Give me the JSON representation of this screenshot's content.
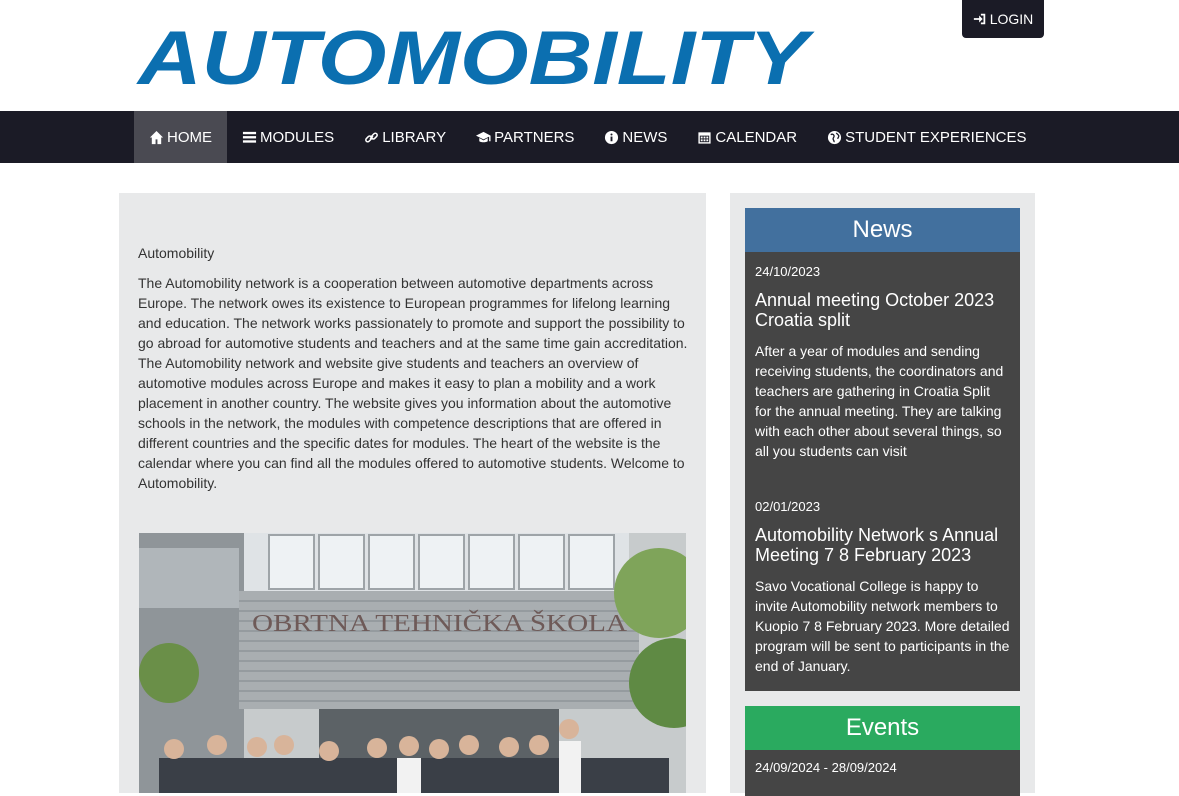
{
  "header": {
    "logo_text": "AUTOMOBILITY",
    "login_label": "LOGIN",
    "brand_color": "#0b6fb0"
  },
  "nav": {
    "items": [
      {
        "label": "HOME",
        "icon": "home-icon"
      },
      {
        "label": "MODULES",
        "icon": "list-icon"
      },
      {
        "label": "LIBRARY",
        "icon": "link-icon"
      },
      {
        "label": "PARTNERS",
        "icon": "graduation-cap-icon"
      },
      {
        "label": "NEWS",
        "icon": "info-circle-icon"
      },
      {
        "label": "CALENDAR",
        "icon": "calendar-icon"
      },
      {
        "label": "STUDENT EXPERIENCES",
        "icon": "globe-icon"
      }
    ]
  },
  "main": {
    "title": "Automobility",
    "text": "The Automobility network is a cooperation between automotive departments across Europe. The network owes its existence to European programmes for lifelong learning and education. The network works passionately to promote and support the possibility to go abroad for automotive students and teachers and at the same time gain accreditation. The Automobility network and website give students and teachers an overview of automotive modules across Europe and makes it easy to plan a mobility and a work placement in another country. The website gives you information about the automotive schools in the network, the modules with competence descriptions that are offered in different countries and the specific dates for modules. The heart of the website is the calendar where you can find all the modules offered to automotive students. Welcome to Automobility.",
    "photo_sign": "OBRTNA TEHNIČKA ŠKOLA"
  },
  "news": {
    "heading": "News",
    "items": [
      {
        "date": "24/10/2023",
        "title": "Annual meeting October 2023 Croatia split",
        "body": "After a year of modules and sending receiving students, the coordinators and teachers are gathering in Croatia Split for the annual meeting. They are talking with each other about several things, so all you students can visit"
      },
      {
        "date": "02/01/2023",
        "title": "Automobility Network s Annual Meeting 7 8 February 2023",
        "body": "Savo Vocational College is happy to invite Automobility network members to Kuopio 7 8 February 2023. More detailed program will be sent to participants in the end of January."
      }
    ]
  },
  "events": {
    "heading": "Events",
    "first_date": "24/09/2024 - 28/09/2024"
  },
  "colors": {
    "navbar": "#1b1b26",
    "news_header": "#42709e",
    "events_header": "#2aaa5f",
    "news_body": "#454545"
  }
}
